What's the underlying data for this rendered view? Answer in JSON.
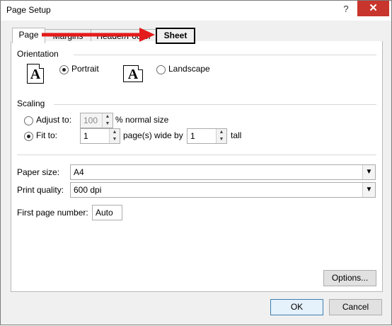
{
  "window": {
    "title": "Page Setup",
    "help_symbol": "?",
    "close_symbol": "✕"
  },
  "tabs": [
    {
      "label": "Page"
    },
    {
      "label": "Margins"
    },
    {
      "label": "Header/Footer"
    },
    {
      "label": "Sheet"
    }
  ],
  "orientation": {
    "heading": "Orientation",
    "portrait_label": "Portrait",
    "landscape_label": "Landscape",
    "icon_glyph": "A",
    "selected": "portrait"
  },
  "scaling": {
    "heading": "Scaling",
    "adjust_to_label": "Adjust to:",
    "adjust_value": "100",
    "adjust_suffix": "% normal size",
    "fit_to_label": "Fit to:",
    "fit_wide_value": "1",
    "fit_wide_suffix": "page(s) wide by",
    "fit_tall_value": "1",
    "fit_tall_suffix": "tall",
    "selected": "fit_to"
  },
  "paper": {
    "size_label": "Paper size:",
    "size_value": "A4"
  },
  "quality": {
    "label": "Print quality:",
    "value": "600 dpi"
  },
  "first_page": {
    "label": "First page number:",
    "value": "Auto"
  },
  "buttons": {
    "options": "Options...",
    "ok": "OK",
    "cancel": "Cancel"
  },
  "colors": {
    "annotation_arrow": "#e31b1b",
    "close_button": "#c7352c"
  }
}
